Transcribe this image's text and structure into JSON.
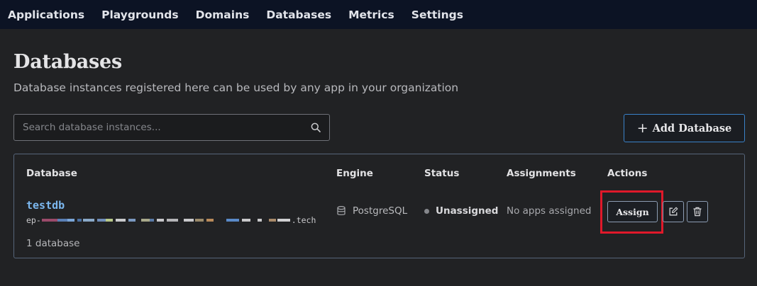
{
  "nav": {
    "items": [
      "Applications",
      "Playgrounds",
      "Domains",
      "Databases",
      "Metrics",
      "Settings"
    ]
  },
  "page": {
    "title": "Databases",
    "subtitle": "Database instances registered here can be used by any app in your organization"
  },
  "search": {
    "placeholder": "Search database instances...",
    "value": "",
    "icon": "search-icon"
  },
  "add_button": {
    "icon": "plus-icon",
    "label": "Add Database",
    "accent": "#3a82c9"
  },
  "table": {
    "headers": {
      "database": "Database",
      "engine": "Engine",
      "status": "Status",
      "assignments": "Assignments",
      "actions": "Actions"
    },
    "rows": [
      {
        "name": "testdb",
        "host_prefix": "ep-",
        "host_suffix": ".tech",
        "host_redacted": true,
        "engine": "PostgreSQL",
        "engine_icon": "database-icon",
        "status": "Unassigned",
        "status_color": "#85878c",
        "assignments": "No apps assigned",
        "actions": {
          "assign_label": "Assign",
          "edit_icon": "edit-icon",
          "delete_icon": "trash-icon"
        }
      }
    ],
    "count_text": "1 database"
  },
  "colors": {
    "background": "#212224",
    "nav_background": "#0c1324",
    "link": "#7cb8f0",
    "highlight": "#e0192a"
  }
}
